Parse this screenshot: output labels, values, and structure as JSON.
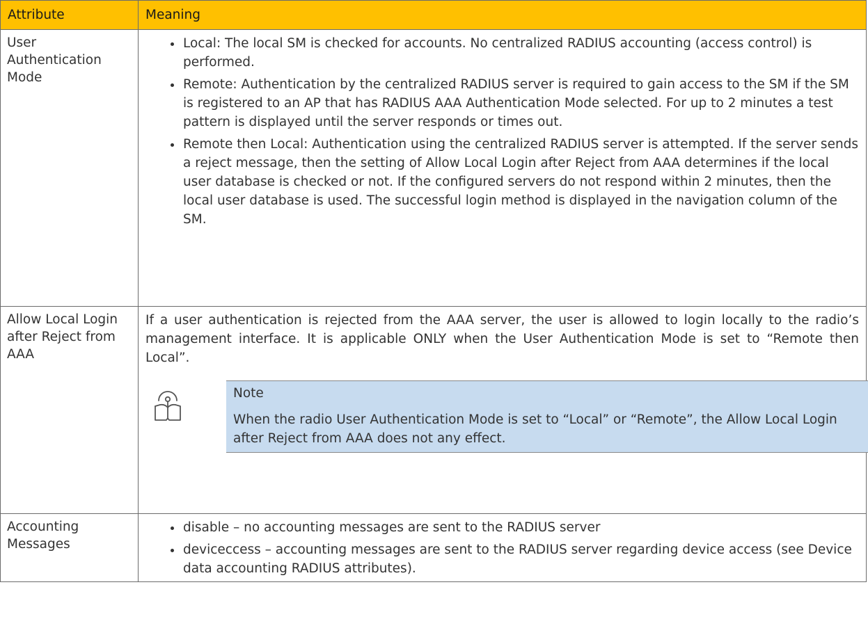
{
  "table": {
    "headers": {
      "attribute": "Attribute",
      "meaning": "Meaning"
    },
    "rows": [
      {
        "attribute": "User Authentication Mode",
        "bullets": [
          "Local: The local SM is checked for accounts. No centralized RADIUS accounting (access control) is performed.",
          "Remote: Authentication by the centralized RADIUS server is required to gain access to the SM if the SM is registered to an AP that has RADIUS AAA Authentication Mode selected. For up to 2 minutes a test pattern is displayed until the server responds or times out.",
          "Remote then Local: Authentication using the centralized RADIUS server is attempted. If the server sends a reject message, then the setting of Allow Local Login after Reject from AAA determines if the local user database is checked or not. If the configured servers do not respond within 2 minutes, then the local user database is used. The successful login method is displayed in the navigation column of the SM."
        ]
      },
      {
        "attribute": "Allow Local Login after Reject from AAA",
        "paragraph": "If a user authentication is rejected from the AAA server, the user is allowed to login locally to the radio’s management interface. It is applicable ONLY when the User Authentication Mode is set to “Remote then Local”.",
        "note": {
          "icon": "note-book-icon",
          "title": "Note",
          "text": "When the radio User Authentication Mode is set to “Local” or “Remote”, the Allow Local Login after Reject from AAA does not any effect."
        }
      },
      {
        "attribute": "Accounting Messages",
        "bullets": [
          "disable – no accounting messages are sent to the RADIUS server",
          "deviceccess – accounting messages are sent to the RADIUS server regarding device access (see Device data accounting RADIUS attributes)."
        ]
      }
    ]
  },
  "colors": {
    "header_bg": "#ffc000",
    "note_bg": "#c7dbef",
    "border": "#6b6b6b"
  }
}
